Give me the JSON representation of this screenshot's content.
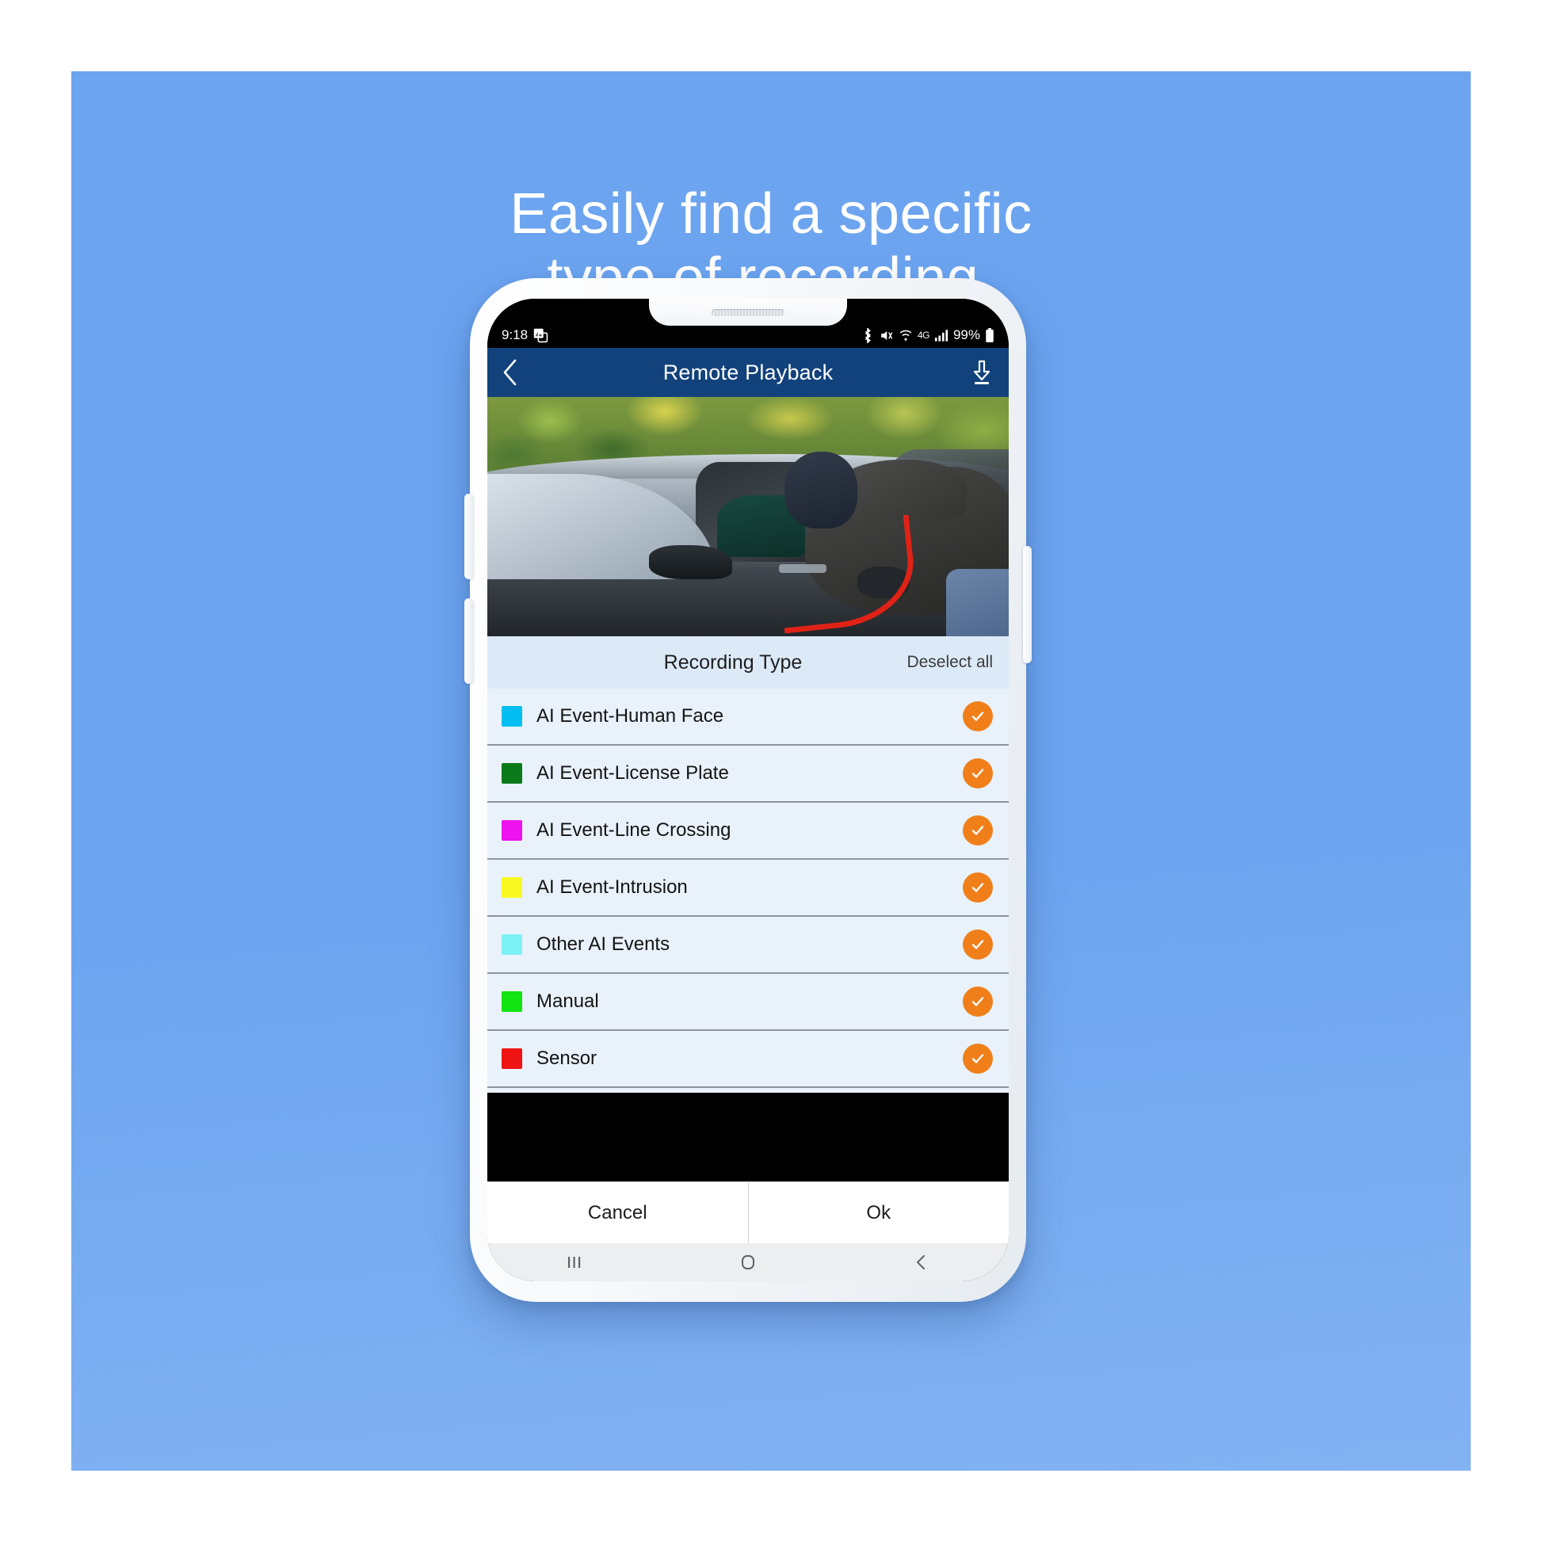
{
  "promo": {
    "headline": "Easily find a specific\ntype of recording.",
    "background_color": "#6ca4f0",
    "headline_color": "#ffffff"
  },
  "phone": {
    "frame_color": "#ffffff",
    "buttons": {
      "volume_up": "volume-up",
      "volume_down": "volume-down",
      "power": "power"
    }
  },
  "status_bar": {
    "time": "9:18",
    "notification_icon": "screenshot-icon",
    "icons": [
      "bluetooth-icon",
      "vibrate-mute-icon",
      "wifi-icon",
      "4g-lte-icon",
      "signal-bars-icon"
    ],
    "network_label": "4G",
    "battery_percent": "99%",
    "background_color": "#000000"
  },
  "app_bar": {
    "title": "Remote Playback",
    "back_icon": "chevron-left-icon",
    "download_icon": "download-icon",
    "background_color": "#12427c",
    "text_color": "#ffffff"
  },
  "video_preview": {
    "description": "Masked intruder breaking into a dark car with a red crowbar"
  },
  "recording_type": {
    "title": "Recording Type",
    "deselect_all_label": "Deselect all",
    "header_background": "#dceaf8",
    "check_color": "#f07f1a",
    "rows": [
      {
        "label": "AI Event-Human Face",
        "swatch_color": "#00bff0",
        "checked": true
      },
      {
        "label": "AI Event-License Plate",
        "swatch_color": "#0a7a1b",
        "checked": true
      },
      {
        "label": "AI Event-Line Crossing",
        "swatch_color": "#ee12ee",
        "checked": true
      },
      {
        "label": "AI Event-Intrusion",
        "swatch_color": "#f8f822",
        "checked": true
      },
      {
        "label": "Other AI Events",
        "swatch_color": "#7df2f5",
        "checked": true
      },
      {
        "label": "Manual",
        "swatch_color": "#12e512",
        "checked": true
      },
      {
        "label": "Sensor",
        "swatch_color": "#ee1414",
        "checked": true
      }
    ]
  },
  "actions": {
    "cancel_label": "Cancel",
    "ok_label": "Ok"
  },
  "android_nav": {
    "recents_icon": "recents-icon",
    "home_icon": "home-icon",
    "back_icon": "back-chevron-icon"
  }
}
